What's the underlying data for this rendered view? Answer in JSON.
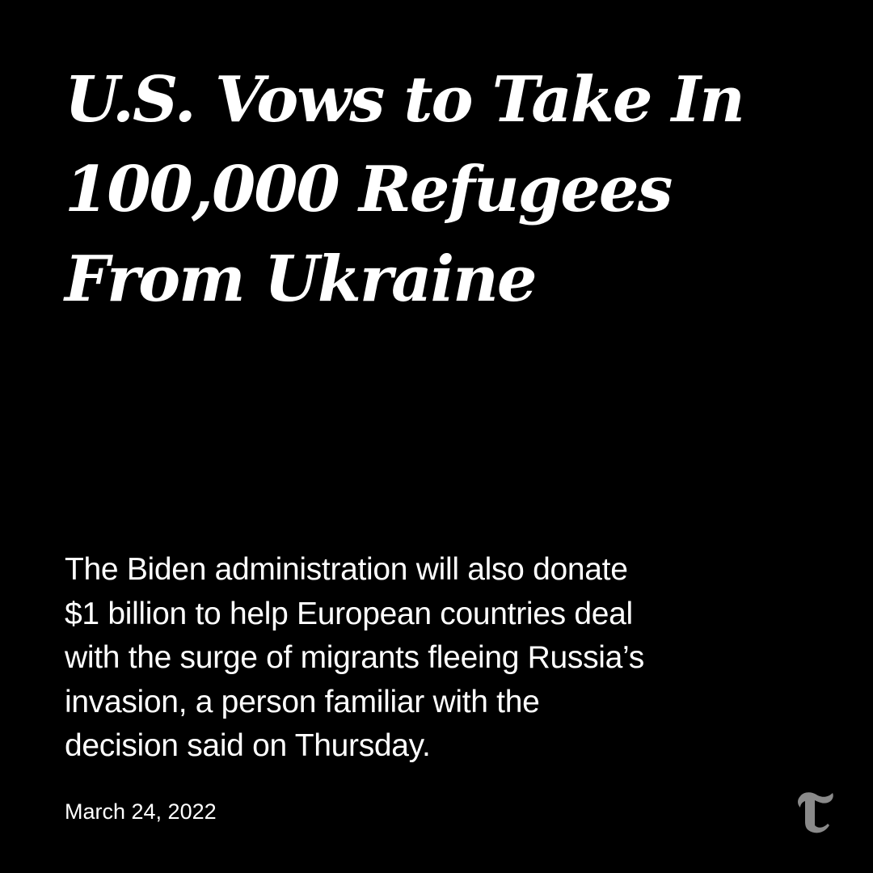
{
  "headline": {
    "lines": [
      "U.S. Vows to Take In",
      "100,000 Refugees",
      "From Ukraine"
    ]
  },
  "summary": {
    "lines": [
      "The Biden administration will also donate",
      "$1 billion to help European countries deal",
      "with the surge of migrants fleeing Russia’s",
      "invasion, a person familiar with the",
      "decision said on Thursday."
    ]
  },
  "date": "March 24, 2022",
  "logo": {
    "icon": "nyt-t-logo-icon",
    "glyph": "T",
    "color": "#8a8a8a"
  },
  "colors": {
    "background": "#000000",
    "text": "#ffffff"
  }
}
